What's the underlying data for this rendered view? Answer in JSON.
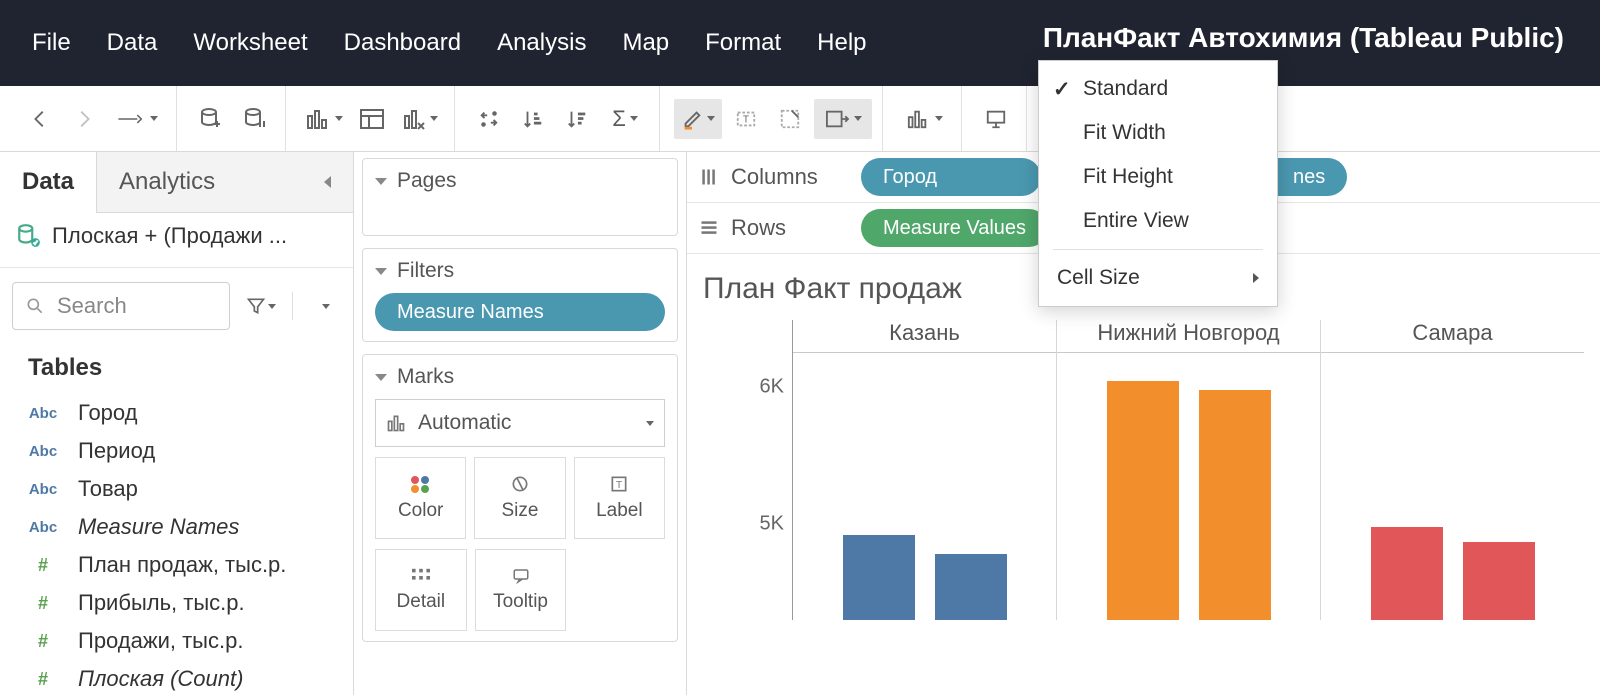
{
  "window_title": "ПланФакт Автохимия (Tableau Public)",
  "menu": [
    "File",
    "Data",
    "Worksheet",
    "Dashboard",
    "Analysis",
    "Map",
    "Format",
    "Help"
  ],
  "data_pane": {
    "tabs": [
      "Data",
      "Analytics"
    ],
    "datasource": "Плоская + (Продажи ...",
    "search_placeholder": "Search",
    "tables_header": "Tables",
    "fields": [
      {
        "icon": "Abc",
        "type": "dim",
        "label": "Город"
      },
      {
        "icon": "Abc",
        "type": "dim",
        "label": "Период"
      },
      {
        "icon": "Abc",
        "type": "dim",
        "label": "Товар"
      },
      {
        "icon": "Abc",
        "type": "dim",
        "label": "Measure Names",
        "italic": true
      },
      {
        "icon": "#",
        "type": "meas",
        "label": "План продаж, тыс.р."
      },
      {
        "icon": "#",
        "type": "meas",
        "label": "Прибыль,  тыс.р."
      },
      {
        "icon": "#",
        "type": "meas",
        "label": "Продажи,  тыс.р."
      },
      {
        "icon": "#",
        "type": "meas",
        "label": "Плоская (Count)",
        "italic": true
      }
    ]
  },
  "shelves": {
    "pages": "Pages",
    "filters": "Filters",
    "filter_pill": "Measure Names",
    "marks": "Marks",
    "mark_type": "Automatic",
    "cards": [
      "Color",
      "Size",
      "Label",
      "Detail",
      "Tooltip"
    ]
  },
  "colrow": {
    "columns_label": "Columns",
    "rows_label": "Rows",
    "col_pill_1": "Город",
    "col_pill_2": "nes",
    "row_pill": "Measure Values"
  },
  "fit_menu": {
    "items": [
      "Standard",
      "Fit Width",
      "Fit Height",
      "Entire View"
    ],
    "selected": "Standard",
    "cell_size": "Cell Size"
  },
  "viz_title": "План Факт продаж ",
  "chart_data": {
    "type": "bar",
    "y_ticks": [
      {
        "v": 6000,
        "label": "6K"
      },
      {
        "v": 5000,
        "label": "5K"
      }
    ],
    "y_domain": [
      4300,
      6200
    ],
    "categories": [
      "Казань",
      "Нижний Новгород",
      "Самара"
    ],
    "series_colors": [
      "#4e79a7",
      "#f28e2b",
      "#e15759"
    ],
    "bars": [
      {
        "city": "Казань",
        "values": [
          4920,
          4780
        ],
        "color": "#4e79a7"
      },
      {
        "city": "Нижний Новгород",
        "values": [
          6050,
          5980
        ],
        "color": "#f28e2b"
      },
      {
        "city": "Самара",
        "values": [
          4980,
          4870
        ],
        "color": "#e15759"
      }
    ]
  }
}
